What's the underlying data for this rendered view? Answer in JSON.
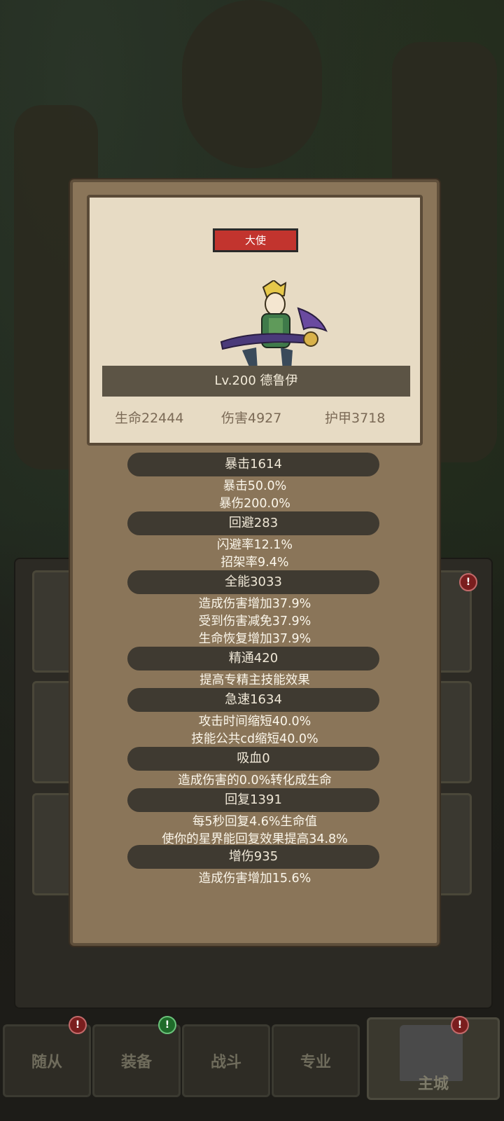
{
  "hero": {
    "rank": "大使",
    "title": "Lv.200 德鲁伊",
    "stats": {
      "hp": "生命22444",
      "damage": "伤害4927",
      "armor": "护甲3718"
    }
  },
  "attributes": {
    "crit": {
      "title": "暴击1614",
      "lines": [
        "暴击50.0%",
        "暴伤200.0%"
      ]
    },
    "dodge": {
      "title": "回避283",
      "lines": [
        "闪避率12.1%",
        "招架率9.4%"
      ]
    },
    "versatility": {
      "title": "全能3033",
      "lines": [
        "造成伤害增加37.9%",
        "受到伤害减免37.9%",
        "生命恢复增加37.9%"
      ]
    },
    "mastery": {
      "title": "精通420",
      "lines": [
        "提高专精主技能效果"
      ]
    },
    "haste": {
      "title": "急速1634",
      "lines": [
        "攻击时间缩短40.0%",
        "技能公共cd缩短40.0%"
      ]
    },
    "leech": {
      "title": "吸血0",
      "lines": [
        "造成伤害的0.0%转化成生命"
      ]
    },
    "regen": {
      "title": "回复1391",
      "lines": [
        "每5秒回复4.6%生命值",
        "使你的星界能回复效果提高34.8%"
      ]
    },
    "dmg_boost": {
      "title": "增伤935",
      "lines": [
        "造成伤害增加15.6%"
      ]
    }
  },
  "nav": {
    "followers": "随从",
    "equipment": "装备",
    "battle": "战斗",
    "profession": "专业",
    "main_city": "主城"
  },
  "colors": {
    "modal_bg": "#8a7559",
    "card_bg": "#e7dbc4",
    "badge_red": "#c2342e",
    "stat_bar": "#3f3a31"
  }
}
